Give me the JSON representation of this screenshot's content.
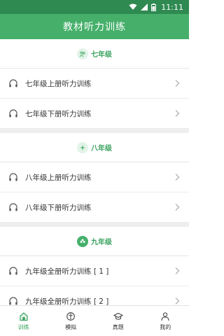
{
  "status_bar": {
    "time": "11:11"
  },
  "header": {
    "title": "教材听力训练"
  },
  "sections": [
    {
      "grade": "七年级",
      "icon": "people-icon",
      "items": [
        {
          "label": "七年级上册听力训练"
        },
        {
          "label": "七年级下册听力训练"
        }
      ]
    },
    {
      "grade": "八年级",
      "icon": "sparkle-icon",
      "items": [
        {
          "label": "八年级上册听力训练"
        },
        {
          "label": "八年级下册听力训练"
        }
      ]
    },
    {
      "grade": "九年级",
      "icon": "flower-icon",
      "items": [
        {
          "label": "九年级全册听力训练 [ 1 ]"
        },
        {
          "label": "九年级全册听力训练 [ 2 ]"
        }
      ]
    }
  ],
  "tabs": [
    {
      "label": "训练",
      "icon": "home-icon",
      "active": true
    },
    {
      "label": "模拟",
      "icon": "compass-icon",
      "active": false
    },
    {
      "label": "真题",
      "icon": "graduation-cap-icon",
      "active": false
    },
    {
      "label": "我的",
      "icon": "person-icon",
      "active": false
    }
  ],
  "colors": {
    "accent": "#46b06b",
    "status_bar": "#2f8a52",
    "divider": "#eeeeee"
  }
}
